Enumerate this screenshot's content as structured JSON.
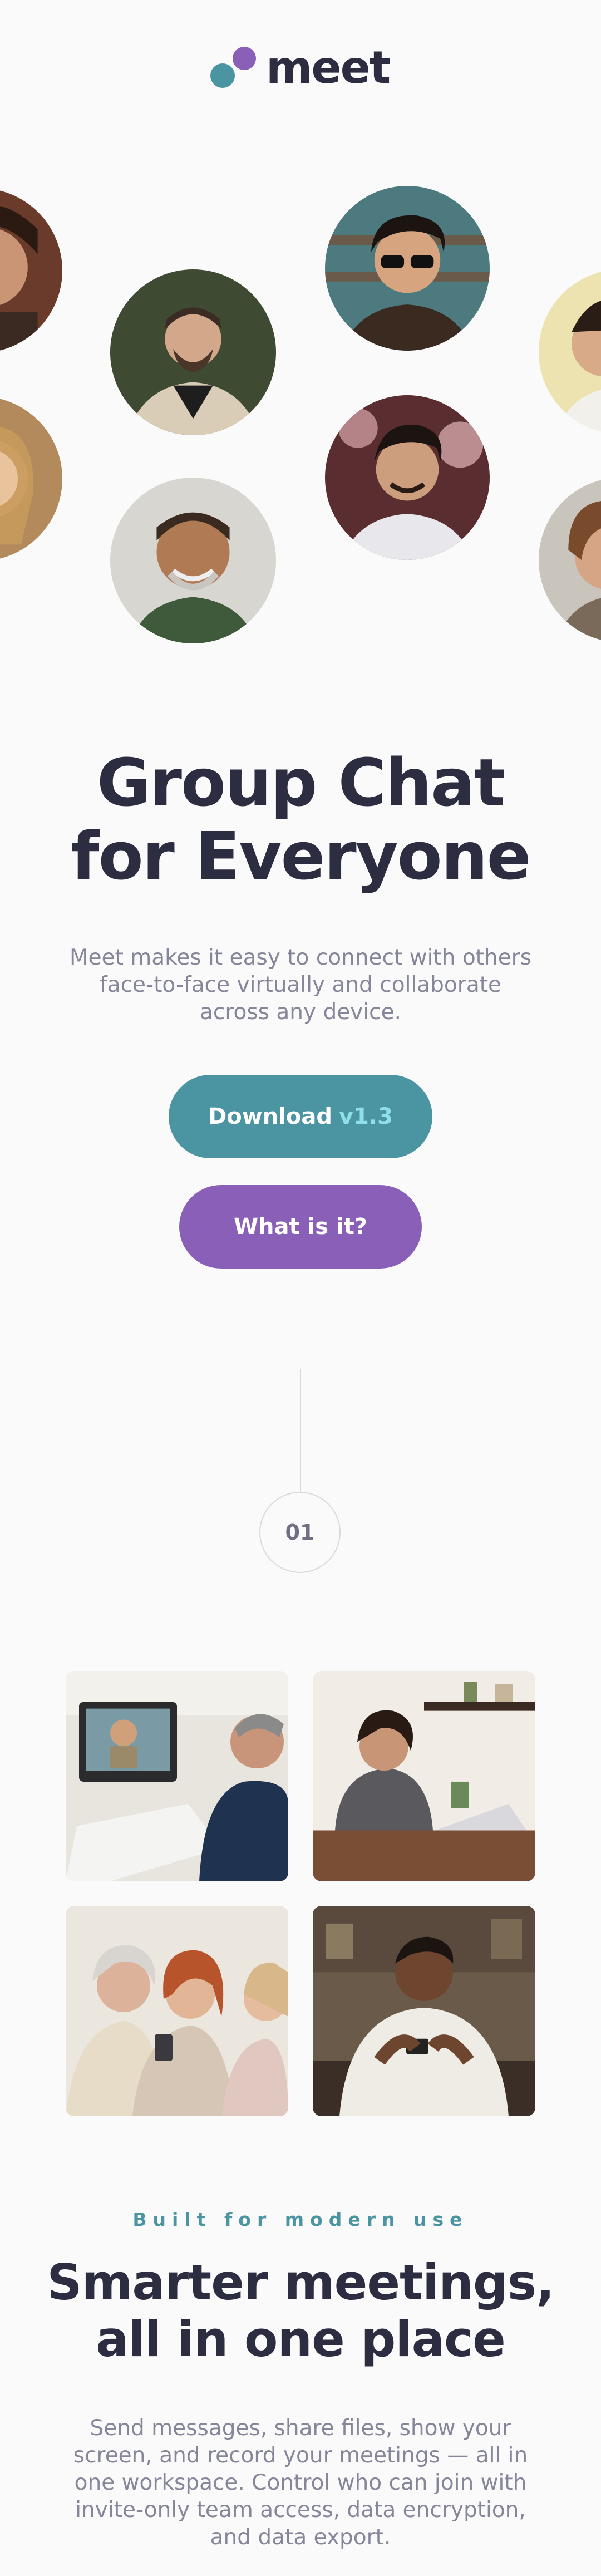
{
  "brand": {
    "name": "meet",
    "colors": {
      "teal": "#4b94a1",
      "purple": "#8a5fb8",
      "dark": "#2d2d42",
      "muted": "#86869a",
      "light_teal": "#8fdfe8"
    }
  },
  "hero": {
    "title_line1": "Group Chat",
    "title_line2": "for Everyone",
    "description": "Meet makes it easy to connect with others face-to-face virtually and collaborate across any device.",
    "download_label": "Download",
    "download_version": "v1.3",
    "what_label": "What is it?"
  },
  "step": {
    "number": "01"
  },
  "features": {
    "eyebrow": "Built for modern use",
    "title_line1": "Smarter meetings,",
    "title_line2": "all in one place",
    "description": "Send messages, share files, show your screen, and record your meetings — all in one workspace. Control who can join with invite-only team access, data encryption, and data export."
  }
}
